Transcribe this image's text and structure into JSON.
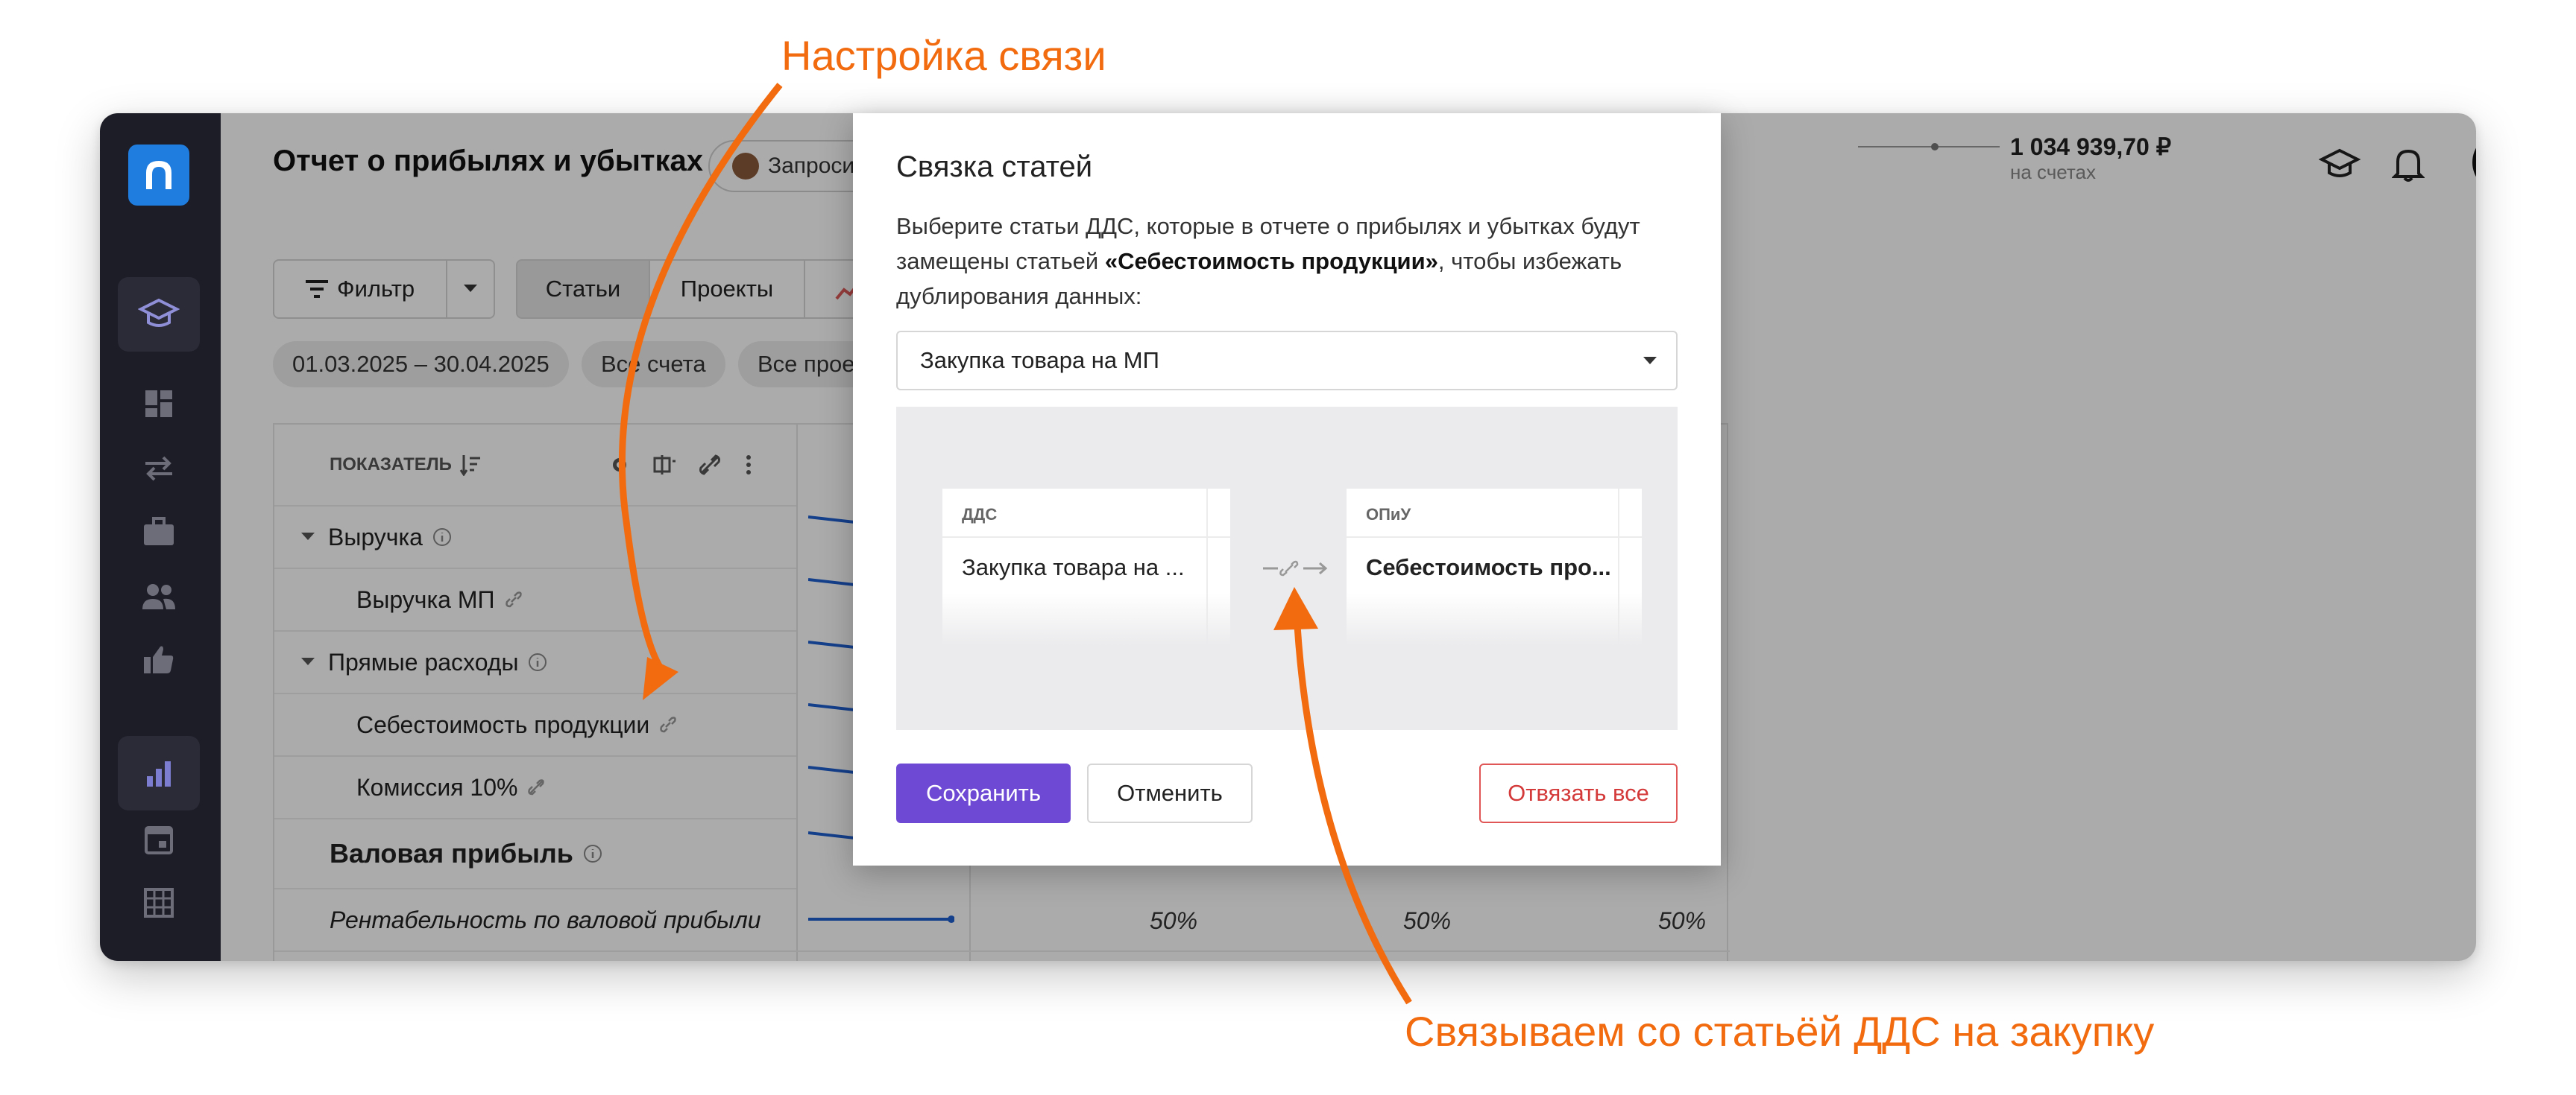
{
  "annotations": {
    "top": "Настройка связи",
    "bottom": "Связываем со статьёй ДДС на закупку"
  },
  "header": {
    "title": "Отчет о прибылях и убытках",
    "request_button": "Запроси",
    "balance_amount": "1 034 939,70 ₽",
    "balance_label": "на счетах"
  },
  "toolbar": {
    "filter": "Фильтр",
    "tab_articles": "Статьи",
    "tab_projects": "Проекты"
  },
  "filters": {
    "date_range": "01.03.2025 – 30.04.2025",
    "accounts": "Все счета",
    "projects": "Все прое"
  },
  "table": {
    "header": "ПОКАЗАТЕЛЬ",
    "rows": [
      {
        "label": "Выручка"
      },
      {
        "label": "Выручка МП"
      },
      {
        "label": "Прямые расходы"
      },
      {
        "label": "Себестоимость продукции"
      },
      {
        "label": "Комиссия 10%"
      },
      {
        "label": "Валовая прибыль"
      },
      {
        "label": "Рентабельность по валовой прибыли"
      }
    ],
    "margin_values": [
      "50%",
      "50%",
      "50%"
    ]
  },
  "modal": {
    "title": "Связка статей",
    "desc_before": "Выберите статьи ДДС, которые в отчете о прибылях и убытках будут замещены статьей ",
    "desc_bold": "«Себестоимость продукции»",
    "desc_after": ", чтобы избежать дублирования данных:",
    "select_value": "Закупка товара на МП",
    "preview_left_header": "ДДС",
    "preview_left_value": "Закупка товара на ...",
    "preview_right_header": "ОПиУ",
    "preview_right_value": "Себестоимость про...",
    "save": "Сохранить",
    "cancel": "Отменить",
    "unlink_all": "Отвязать все"
  },
  "colors": {
    "accent": "#6e4ad4",
    "annotation": "#f26b0f",
    "danger": "#d43a3a",
    "logo": "#1f7de0"
  }
}
